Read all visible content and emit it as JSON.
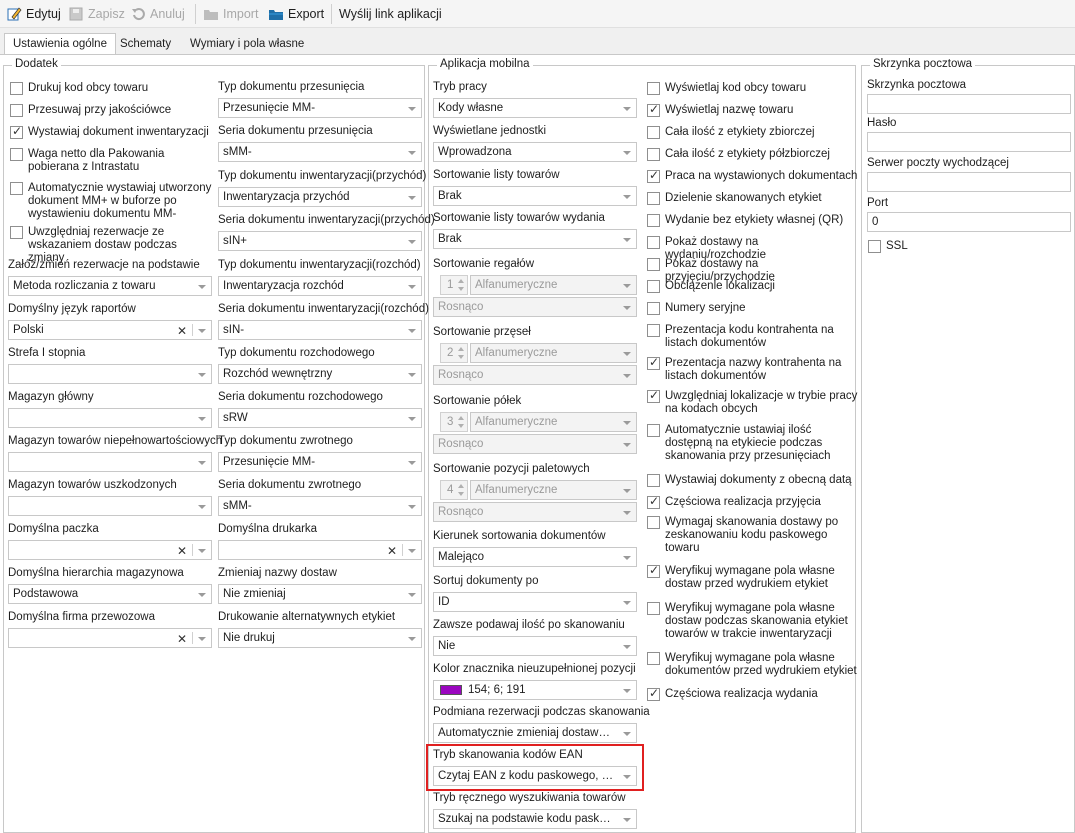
{
  "toolbar": {
    "edit": "Edytuj",
    "save": "Zapisz",
    "cancel": "Anuluj",
    "import": "Import",
    "export": "Export",
    "send_link": "Wyślij link aplikacji"
  },
  "tabs": [
    "Ustawienia ogólne",
    "Schematy",
    "Wymiary i pola własne"
  ],
  "dodatek": {
    "title": "Dodatek",
    "checkboxes": [
      {
        "label": "Drukuj kod obcy towaru",
        "checked": false
      },
      {
        "label": "Przesuwaj przy jakościówce",
        "checked": false
      },
      {
        "label": "Wystawiaj dokument inwentaryzacji",
        "checked": true
      },
      {
        "label": "Waga netto dla Pakowania pobierana z Intrastatu",
        "checked": false
      },
      {
        "label": "Automatycznie wystawiaj utworzony dokument MM+ w buforze po wystawieniu dokumentu MM-",
        "checked": false
      },
      {
        "label": "Uwzględniaj rezerwacje ze wskazaniem dostaw podczas zmiany",
        "checked": false
      }
    ],
    "left_fields": [
      {
        "label": "Załóż/zmień rezerwacje na podstawie",
        "value": "Metoda rozliczania z towaru",
        "clear": false
      },
      {
        "label": "Domyślny język raportów",
        "value": "Polski",
        "clear": true
      },
      {
        "label": "Strefa I stopnia",
        "value": "",
        "clear": false
      },
      {
        "label": "Magazyn główny",
        "value": "",
        "clear": false
      },
      {
        "label": "Magazyn towarów niepełnowartościowych",
        "value": "",
        "clear": false
      },
      {
        "label": "Magazyn towarów uszkodzonych",
        "value": "",
        "clear": false
      },
      {
        "label": "Domyślna paczka",
        "value": "",
        "clear": true
      },
      {
        "label": "Domyślna hierarchia magazynowa",
        "value": "Podstawowa",
        "clear": false
      },
      {
        "label": "Domyślna firma przewozowa",
        "value": "",
        "clear": true
      }
    ],
    "right_fields": [
      {
        "label": "Typ dokumentu przesunięcia",
        "value": "Przesunięcie MM-",
        "clear": false
      },
      {
        "label": "Seria dokumentu przesunięcia",
        "value": "sMM-",
        "clear": false
      },
      {
        "label": "Typ dokumentu inwentaryzacji(przychód)",
        "value": "Inwentaryzacja przychód",
        "clear": false
      },
      {
        "label": "Seria dokumentu inwentaryzacji(przychód)",
        "value": "sIN+",
        "clear": false
      },
      {
        "label": "Typ dokumentu inwentaryzacji(rozchód)",
        "value": "Inwentaryzacja rozchód",
        "clear": false
      },
      {
        "label": "Seria dokumentu inwentaryzacji(rozchód)",
        "value": "sIN-",
        "clear": false
      },
      {
        "label": "Typ dokumentu rozchodowego",
        "value": "Rozchód wewnętrzny",
        "clear": false
      },
      {
        "label": "Seria dokumentu rozchodowego",
        "value": "sRW",
        "clear": false
      },
      {
        "label": "Typ dokumentu zwrotnego",
        "value": "Przesunięcie MM-",
        "clear": false
      },
      {
        "label": "Seria dokumentu zwrotnego",
        "value": "sMM-",
        "clear": false
      },
      {
        "label": "Domyślna drukarka",
        "value": "",
        "clear": true
      },
      {
        "label": "Zmieniaj nazwy dostaw",
        "value": "Nie zmieniaj",
        "clear": false
      },
      {
        "label": "Drukowanie alternatywnych etykiet",
        "value": "Nie drukuj",
        "clear": false
      }
    ]
  },
  "mobile": {
    "title": "Aplikacja mobilna",
    "fields_top": [
      {
        "label": "Tryb pracy",
        "value": "Kody własne"
      },
      {
        "label": "Wyświetlane jednostki",
        "value": "Wprowadzona"
      },
      {
        "label": "Sortowanie listy towarów",
        "value": "Brak"
      },
      {
        "label": "Sortowanie listy towarów wydania",
        "value": "Brak"
      }
    ],
    "sort_groups": [
      {
        "label": "Sortowanie regałów",
        "num": "1",
        "type": "Alfanumeryczne",
        "order": "Rosnąco"
      },
      {
        "label": "Sortowanie przęseł",
        "num": "2",
        "type": "Alfanumeryczne",
        "order": "Rosnąco"
      },
      {
        "label": "Sortowanie półek",
        "num": "3",
        "type": "Alfanumeryczne",
        "order": "Rosnąco"
      },
      {
        "label": "Sortowanie pozycji paletowych",
        "num": "4",
        "type": "Alfanumeryczne",
        "order": "Rosnąco"
      }
    ],
    "fields_bottom": [
      {
        "label": "Kierunek sortowania dokumentów",
        "value": "Malejąco"
      },
      {
        "label": "Sortuj dokumenty po",
        "value": "ID"
      },
      {
        "label": "Zawsze podawaj ilość po skanowaniu",
        "value": "Nie"
      },
      {
        "label": "Kolor znacznika nieuzupełnionej pozycji",
        "value": "154; 6; 191"
      },
      {
        "label": "Podmiana rezerwacji podczas skanowania",
        "value": "Automatycznie zmieniaj dostawę po..."
      },
      {
        "label": "Tryb skanowania kodów EAN",
        "value": "Czytaj EAN z kodu paskowego, kod..."
      },
      {
        "label": "Tryb ręcznego wyszukiwania towarów",
        "value": "Szukaj na podstawie kodu paskowe..."
      }
    ],
    "marker_color": "#9a06bf",
    "checkboxes": [
      {
        "label": "Wyświetlaj kod obcy towaru",
        "checked": false
      },
      {
        "label": "Wyświetlaj nazwę towaru",
        "checked": true
      },
      {
        "label": "Cała ilość z etykiety zbiorczej",
        "checked": false
      },
      {
        "label": "Cała ilość z etykiety półzbiorczej",
        "checked": false
      },
      {
        "label": "Praca na wystawionych dokumentach",
        "checked": true
      },
      {
        "label": "Dzielenie skanowanych etykiet",
        "checked": false
      },
      {
        "label": "Wydanie bez etykiety własnej (QR)",
        "checked": false
      },
      {
        "label": "Pokaż dostawy na wydaniu/rozchodzie",
        "checked": false
      },
      {
        "label": "Pokaż dostawy na przyjęciu/przychodzie",
        "checked": false
      },
      {
        "label": "Obciążenie lokalizacji",
        "checked": false
      },
      {
        "label": "Numery seryjne",
        "checked": false
      },
      {
        "label": "Prezentacja kodu kontrahenta na listach dokumentów",
        "checked": false
      },
      {
        "label": "Prezentacja nazwy kontrahenta na listach dokumentów",
        "checked": true
      },
      {
        "label": "Uwzględniaj lokalizacje w trybie pracy na kodach obcych",
        "checked": true
      },
      {
        "label": "Automatycznie ustawiaj ilość dostępną na etykiecie podczas skanowania przy przesunięciach",
        "checked": false
      },
      {
        "label": "Wystawiaj dokumenty z obecną datą",
        "checked": false
      },
      {
        "label": "Częściowa realizacja przyjęcia",
        "checked": true
      },
      {
        "label": "Wymagaj skanowania dostawy po zeskanowaniu kodu paskowego towaru",
        "checked": false
      },
      {
        "label": "Weryfikuj wymagane pola własne dostaw przed wydrukiem etykiet",
        "checked": true
      },
      {
        "label": "Weryfikuj wymagane pola własne dostaw podczas skanowania etykiet towarów w trakcie inwentaryzacji",
        "checked": false
      },
      {
        "label": "Weryfikuj wymagane pola własne dokumentów przed wydrukiem etykiet",
        "checked": false
      },
      {
        "label": "Częściowa realizacja wydania",
        "checked": true
      }
    ]
  },
  "mailbox": {
    "title": "Skrzynka pocztowa",
    "fields": [
      {
        "label": "Skrzynka pocztowa",
        "value": ""
      },
      {
        "label": "Hasło",
        "value": ""
      },
      {
        "label": "Serwer poczty wychodzącej",
        "value": ""
      },
      {
        "label": "Port",
        "value": "0"
      }
    ],
    "ssl_label": "SSL",
    "ssl_checked": false
  }
}
